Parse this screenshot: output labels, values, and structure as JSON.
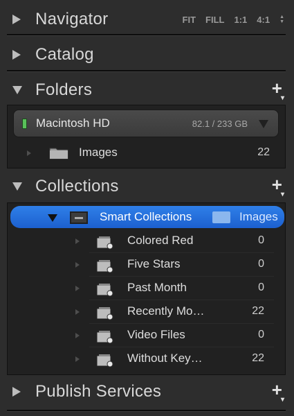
{
  "navigator": {
    "title": "Navigator",
    "options": [
      "FIT",
      "FILL",
      "1:1",
      "4:1"
    ]
  },
  "catalog": {
    "title": "Catalog"
  },
  "folders": {
    "title": "Folders",
    "volume": {
      "name": "Macintosh HD",
      "size": "82.1 / 233 GB",
      "status_color": "#59c25a"
    },
    "items": [
      {
        "label": "Images",
        "count": "22"
      }
    ]
  },
  "collections": {
    "title": "Collections",
    "smart_set": {
      "label": "Smart Collections",
      "filter": "Images"
    },
    "items": [
      {
        "label": "Colored Red",
        "count": "0"
      },
      {
        "label": "Five Stars",
        "count": "0"
      },
      {
        "label": "Past Month",
        "count": "0"
      },
      {
        "label": "Recently Mo…",
        "count": "22"
      },
      {
        "label": "Video Files",
        "count": "0"
      },
      {
        "label": "Without Key…",
        "count": "22"
      }
    ]
  },
  "publish": {
    "title": "Publish Services"
  },
  "colors": {
    "selection": "#2a76e0",
    "panel_bg": "#2d2d2d",
    "well_bg": "#212121"
  }
}
